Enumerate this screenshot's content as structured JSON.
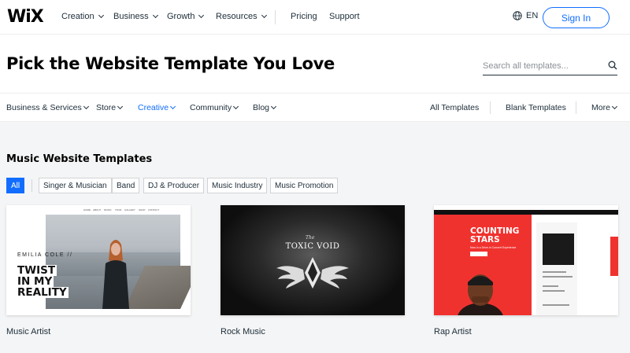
{
  "brand": {
    "logo": "WiX",
    "accent": "#116dff"
  },
  "topnav": {
    "items": [
      "Creation",
      "Business",
      "Growth",
      "Resources"
    ],
    "links": [
      "Pricing",
      "Support"
    ],
    "language": "EN",
    "sign_in": "Sign In"
  },
  "header": {
    "title": "Pick the Website Template You Love",
    "search_placeholder": "Search all templates..."
  },
  "categories": {
    "left": [
      "Business & Services",
      "Store",
      "Creative",
      "Community",
      "Blog"
    ],
    "active": "Creative",
    "right": [
      "All Templates",
      "Blank Templates",
      "More"
    ]
  },
  "section": {
    "title": "Music Website Templates",
    "filters": [
      "All",
      "Singer & Musician",
      "Band",
      "DJ & Producer",
      "Music Industry",
      "Music Promotion"
    ],
    "active_filter": "All"
  },
  "templates": [
    {
      "name": "Music Artist",
      "preview": {
        "nav": [
          "HOME",
          "ABOUT",
          "MUSIC",
          "TOUR",
          "GALLERY",
          "SHOP",
          "CONTACT"
        ],
        "subtitle": "EMILIA COLE //",
        "headline": [
          "TWIST",
          "IN MY",
          "REALITY"
        ]
      }
    },
    {
      "name": "Rock Music",
      "preview": {
        "the": "The",
        "title": "TOXIC VOID"
      }
    },
    {
      "name": "Rap Artist",
      "preview": {
        "title": [
          "COUNTING",
          "STARS"
        ],
        "subtitle": "Now in a Drive-in Concert Experience"
      }
    }
  ]
}
